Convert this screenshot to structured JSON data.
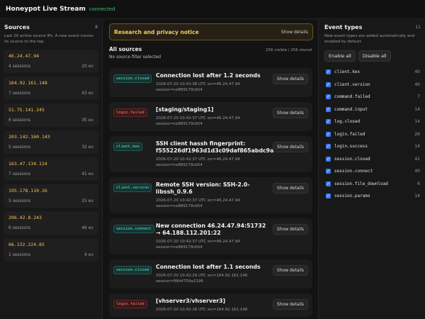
{
  "header": {
    "title": "Honeypot Live Stream",
    "status": "connected"
  },
  "sources": {
    "title": "Sources",
    "count": "8",
    "description": "Last 20 active source IPs. A new event moves its source to the top.",
    "items": [
      {
        "ip": "46.24.47.94",
        "sessions": "4 sessions",
        "age": "20 ev"
      },
      {
        "ip": "164.92.161.148",
        "sessions": "7 sessions",
        "age": "43 ev"
      },
      {
        "ip": "51.75.141.245",
        "sessions": "6 sessions",
        "age": "35 ev"
      },
      {
        "ip": "203.142.160.143",
        "sessions": "5 sessions",
        "age": "32 ev"
      },
      {
        "ip": "163.47.134.124",
        "sessions": "7 sessions",
        "age": "41 ev"
      },
      {
        "ip": "195.178.110.26",
        "sessions": "5 sessions",
        "age": "25 ev"
      },
      {
        "ip": "206.42.8.243",
        "sessions": "6 sessions",
        "age": "46 ev"
      },
      {
        "ip": "66.132.224.85",
        "sessions": "1 sessions",
        "age": "4 ev"
      }
    ]
  },
  "notice": {
    "title": "Research and privacy notice",
    "button": "Show details"
  },
  "events": {
    "title": "All sources",
    "filter_text": "No source filter selected",
    "stats": "256 visible / 256 stored",
    "show_button": "Show details",
    "items": [
      {
        "type": "session.closed",
        "color": "teal",
        "title": "Connection lost after 1.2 seconds",
        "meta": "2026-07-20 10:42:38 UTC   src=46.24.47.94",
        "session": "session=ce889179cb54"
      },
      {
        "type": "login.failed",
        "color": "red",
        "title": "[staging/staging1]",
        "meta": "2026-07-20 10:42:37 UTC   src=46.24.47.94",
        "session": "session=ce889179cb54"
      },
      {
        "type": "client.kex",
        "color": "teal",
        "title": "SSH client hassh fingerprint: f555226df1963d1d3c09daf865abdc9a",
        "meta": "2026-07-20 10:42:37 UTC   src=46.24.47.94",
        "session": "session=ce889179cb54"
      },
      {
        "type": "client.version",
        "color": "teal",
        "title": "Remote SSH version: SSH-2.0-libssh_0.9.6",
        "meta": "2026-07-20 10:42:37 UTC   src=46.24.47.94",
        "session": "session=ce889179cb54"
      },
      {
        "type": "session.connect",
        "color": "teal",
        "title": "New connection 46.24.47.94:51732 → 64.188.112.201:22",
        "meta": "2026-07-20 10:42:37 UTC   src=46.24.47.94",
        "session": "session=ce889179cb54"
      },
      {
        "type": "session.closed",
        "color": "teal",
        "title": "Connection lost after 1.1 seconds",
        "meta": "2026-07-20 10:42:29 UTC   src=164.92.161.148",
        "session": "session=88d4759a2196"
      },
      {
        "type": "login.failed",
        "color": "red",
        "title": "[vhserver3/vhserver3]",
        "meta": "2026-07-20 10:42:28 UTC   src=164.92.161.148",
        "session": ""
      }
    ]
  },
  "event_types": {
    "title": "Event types",
    "count": "11",
    "description": "New event types are added automatically and enabled by default.",
    "enable_all": "Enable all",
    "disable_all": "Disable all",
    "items": [
      {
        "name": "client.kex",
        "count": "40"
      },
      {
        "name": "client.version",
        "count": "40"
      },
      {
        "name": "command.failed",
        "count": "7"
      },
      {
        "name": "command.input",
        "count": "14"
      },
      {
        "name": "log.closed",
        "count": "14"
      },
      {
        "name": "login.failed",
        "count": "26"
      },
      {
        "name": "login.success",
        "count": "14"
      },
      {
        "name": "session.closed",
        "count": "41"
      },
      {
        "name": "session.connect",
        "count": "40"
      },
      {
        "name": "session.file_download",
        "count": "6"
      },
      {
        "name": "session.params",
        "count": "14"
      }
    ]
  }
}
